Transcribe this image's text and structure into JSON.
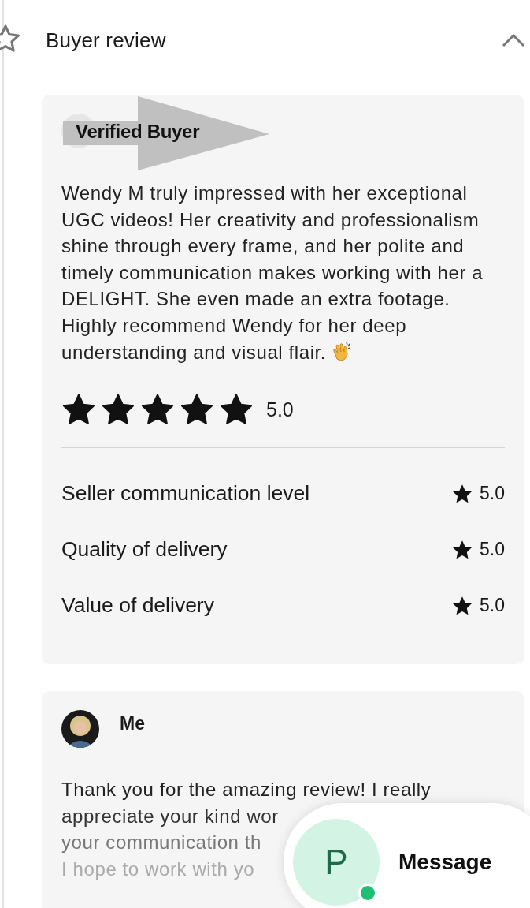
{
  "section": {
    "title": "Buyer review",
    "expanded": true
  },
  "review": {
    "annotation": "Verified Buyer",
    "text": "Wendy M truly impressed with her exceptional UGC videos! Her creativity and professionalism shine through every frame, and her polite and timely communication makes working with her a DELIGHT. She even made an extra footage. Highly recommend Wendy for her deep understanding and visual flair.",
    "stars": 5,
    "rating": "5.0",
    "criteria": [
      {
        "label": "Seller communication level",
        "rating": "5.0"
      },
      {
        "label": "Quality of delivery",
        "rating": "5.0"
      },
      {
        "label": "Value of delivery",
        "rating": "5.0"
      }
    ]
  },
  "reply": {
    "author": "Me",
    "lines": [
      "Thank you for the amazing review! I really",
      "appreciate your kind wor",
      "your communication th",
      "I hope to work with yo"
    ]
  },
  "message_button": {
    "initial": "P",
    "online": true,
    "label": "Message"
  }
}
